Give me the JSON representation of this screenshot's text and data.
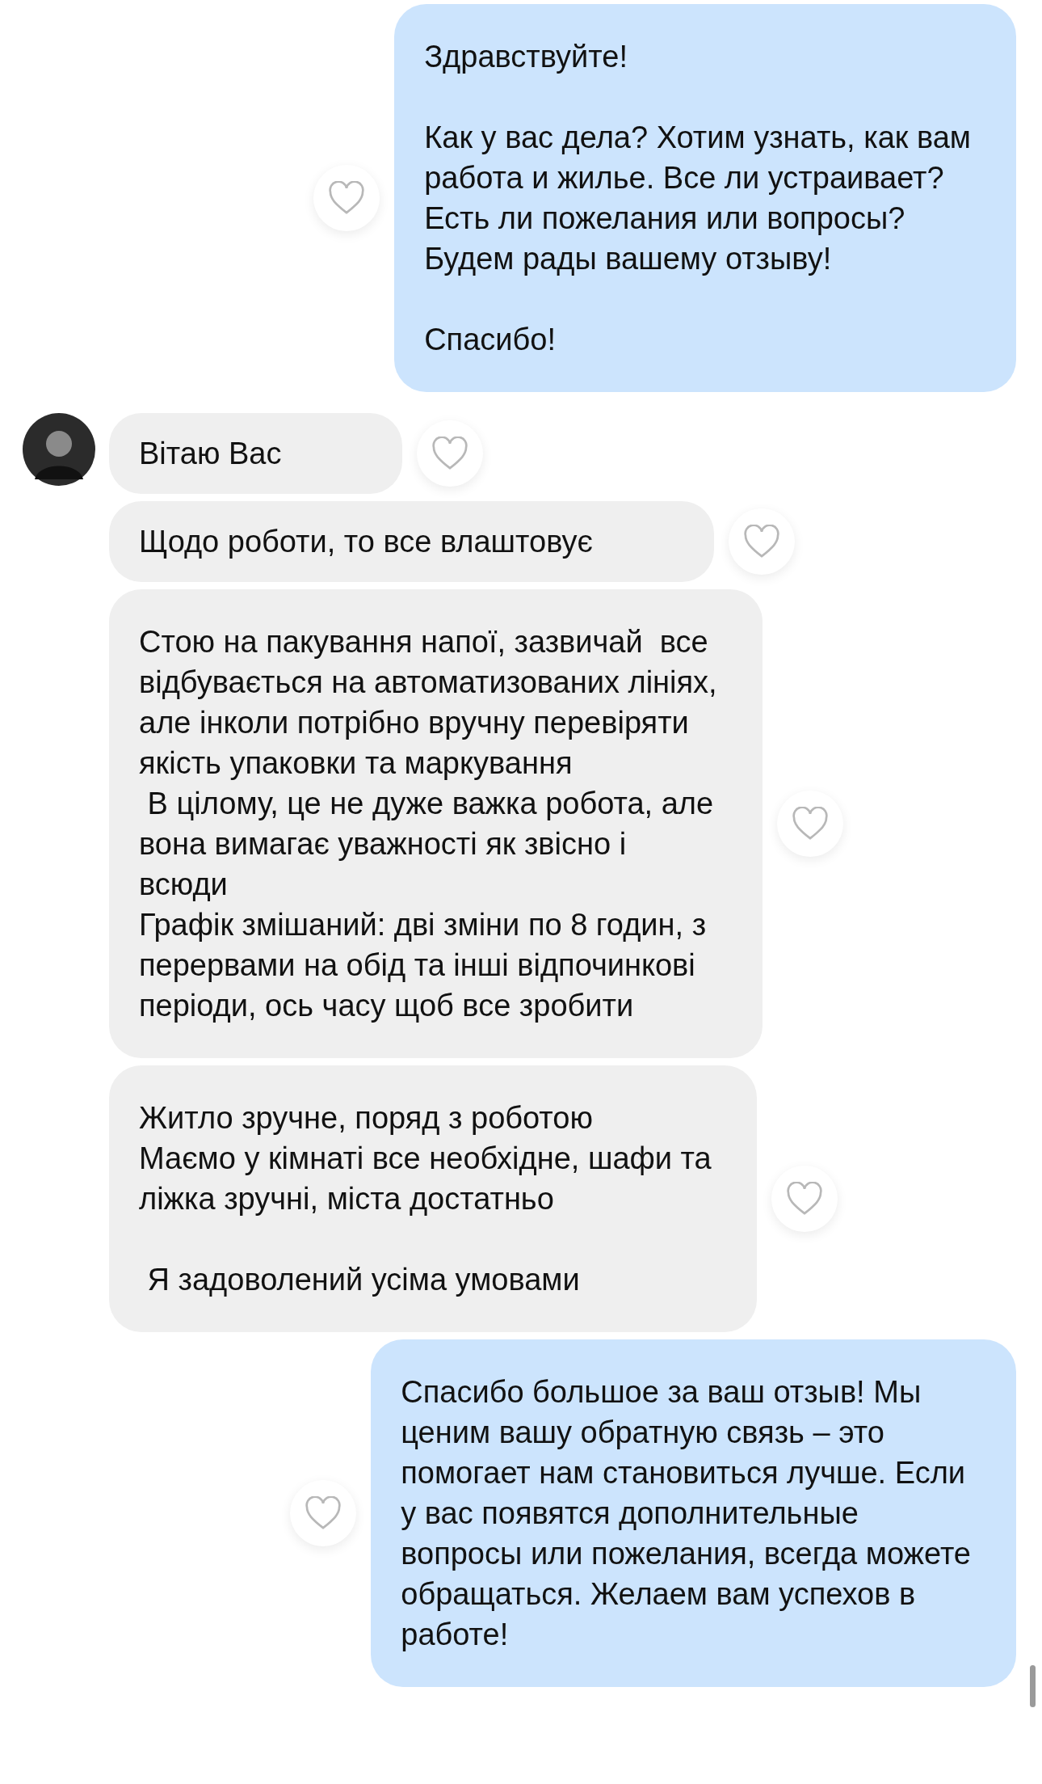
{
  "messages": [
    {
      "kind": "outgoing",
      "text": "Здравствуйте!\n\nКак у вас дела? Хотим узнать, как вам\nработа и жилье. Все ли устраивает?\nЕсть ли пожелания или вопросы?\nБудем рады вашему отзыву!\n\nСпасибо!"
    },
    {
      "kind": "incoming",
      "text": "Вітаю Вас"
    },
    {
      "kind": "incoming",
      "text": "Щодо роботи, то все влаштовує"
    },
    {
      "kind": "incoming",
      "text": "Стою на пакування напої, зазвичай  все\nвідбувається на автоматизованих лініях,\nале інколи потрібно вручну перевіряти\nякість упаковки та маркування\n В цілому, це не дуже важка робота, але\nвона вимагає уважності як звісно і\nвсюди\nГрафік змішаний: дві зміни по 8 годин, з\nперервами на обід та інші відпочинкові\nперіоди, ось часу щоб все зробити"
    },
    {
      "kind": "incoming",
      "text": "Житло зручне, поряд з роботою\nМаємо у кімнаті все необхідне, шафи та\nліжка зручні, міста достатньо\n\n Я задоволений усіма умовами"
    },
    {
      "kind": "outgoing",
      "text": "Спасибо большое за ваш отзыв! Мы\nценим вашу обратную связь – это\nпомогает нам становиться лучше. Если\nу вас появятся дополнительные\nвопросы или пожелания, всегда можете\nобращаться. Желаем вам успехов в\nработе!"
    }
  ]
}
